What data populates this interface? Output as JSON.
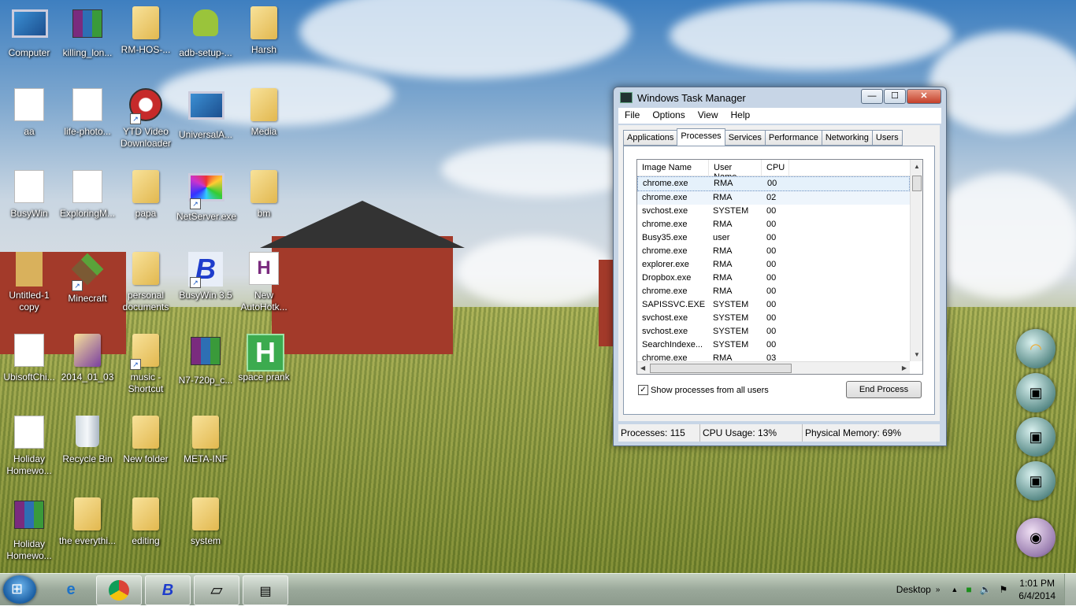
{
  "desktop": {
    "icons": [
      {
        "label": "Computer"
      },
      {
        "label": "killing_lon..."
      },
      {
        "label": "RM-HOS-..."
      },
      {
        "label": "adb-setup-..."
      },
      {
        "label": "Harsh"
      },
      {
        "label": "aa"
      },
      {
        "label": "life-photo..."
      },
      {
        "label": "YTD Video Downloader"
      },
      {
        "label": "UniversalA..."
      },
      {
        "label": "Media"
      },
      {
        "label": "BusyWin"
      },
      {
        "label": "ExploringM..."
      },
      {
        "label": "papa"
      },
      {
        "label": "NetServer.exe"
      },
      {
        "label": "bm"
      },
      {
        "label": "Untitled-1 copy"
      },
      {
        "label": "Minecraft"
      },
      {
        "label": "personal documents"
      },
      {
        "label": "BusyWin 3.5"
      },
      {
        "label": "New AutoHotk..."
      },
      {
        "label": "UbisoftChi..."
      },
      {
        "label": "2014_01_03"
      },
      {
        "label": "music - Shortcut"
      },
      {
        "label": "N7-720p_c..."
      },
      {
        "label": "space prank"
      },
      {
        "label": "Holiday Homewo..."
      },
      {
        "label": "Recycle Bin"
      },
      {
        "label": "New folder"
      },
      {
        "label": "META-INF"
      },
      {
        "label": "Holiday Homewo..."
      },
      {
        "label": "the everythi..."
      },
      {
        "label": "editing"
      },
      {
        "label": "system"
      }
    ]
  },
  "taskmanager": {
    "title": "Windows Task Manager",
    "controls": {
      "minimize": "—",
      "maximize": "☐",
      "close": "✕"
    },
    "menu": [
      "File",
      "Options",
      "View",
      "Help"
    ],
    "tabs": [
      "Applications",
      "Processes",
      "Services",
      "Performance",
      "Networking",
      "Users"
    ],
    "active_tab": "Processes",
    "columns": [
      "Image Name",
      "User Name",
      "CPU"
    ],
    "rows": [
      [
        "chrome.exe",
        "RMA",
        "00"
      ],
      [
        "chrome.exe",
        "RMA",
        "02"
      ],
      [
        "svchost.exe",
        "SYSTEM",
        "00"
      ],
      [
        "chrome.exe",
        "RMA",
        "00"
      ],
      [
        "Busy35.exe",
        "user",
        "00"
      ],
      [
        "chrome.exe",
        "RMA",
        "00"
      ],
      [
        "explorer.exe",
        "RMA",
        "00"
      ],
      [
        "Dropbox.exe",
        "RMA",
        "00"
      ],
      [
        "chrome.exe",
        "RMA",
        "00"
      ],
      [
        "SAPISSVC.EXE",
        "SYSTEM",
        "00"
      ],
      [
        "svchost.exe",
        "SYSTEM",
        "00"
      ],
      [
        "svchost.exe",
        "SYSTEM",
        "00"
      ],
      [
        "SearchIndexe...",
        "SYSTEM",
        "00"
      ],
      [
        "chrome.exe",
        "RMA",
        "03"
      ]
    ],
    "show_all_label": "Show processes from all users",
    "show_all_checked": true,
    "end_process_label": "End Process",
    "status": {
      "processes": "Processes: 115",
      "cpu": "CPU Usage: 13%",
      "memory": "Physical Memory: 69%"
    }
  },
  "taskbar": {
    "desktop_label": "Desktop",
    "time": "1:01 PM",
    "date": "6/4/2014"
  }
}
